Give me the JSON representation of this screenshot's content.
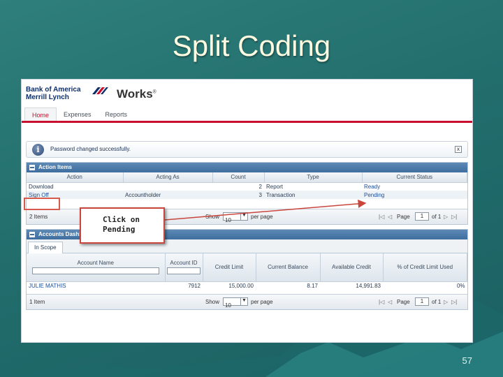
{
  "slide": {
    "title": "Split Coding",
    "page_number": "57"
  },
  "app": {
    "brand_line1": "Bank of America",
    "brand_line2": "Merrill Lynch",
    "product": "Works",
    "product_mark": "®",
    "nav": [
      {
        "label": "Home",
        "active": true
      },
      {
        "label": "Expenses",
        "active": false
      },
      {
        "label": "Reports",
        "active": false
      }
    ],
    "alert": {
      "icon": "info-icon",
      "message": "Password changed successfully.",
      "close": "x"
    }
  },
  "action_items": {
    "title": "Action Items",
    "columns": [
      "Action",
      "Acting As",
      "Count",
      "Type",
      "Current Status"
    ],
    "rows": [
      {
        "action": "Download",
        "acting_as": "",
        "count": "2",
        "type": "Report",
        "status": "Ready"
      },
      {
        "action": "Sign Off",
        "acting_as": "Accountholder",
        "count": "3",
        "type": "Transaction",
        "status": "Pending"
      }
    ],
    "pager": {
      "count_text": "2 Items",
      "show": "Show",
      "per_page_value": "10",
      "per_page": "per page",
      "page_label": "Page",
      "page_value": "1",
      "of_text": "of 1"
    }
  },
  "callout": {
    "line1": "Click on",
    "line2": "Pending"
  },
  "accounts_dashboard": {
    "title": "Accounts Dashboard",
    "tab": "In Scope",
    "columns": [
      "Account Name",
      "Account ID",
      "Credit Limit",
      "Current Balance",
      "Available Credit",
      "% of Credit Limit Used"
    ],
    "rows": [
      {
        "name": "JULIE MATHIS",
        "id": "7912",
        "credit_limit": "15,000.00",
        "current_balance": "8.17",
        "available_credit": "14,991.83",
        "pct_used": "0%"
      }
    ],
    "pager": {
      "count_text": "1 Item",
      "show": "Show",
      "per_page_value": "10",
      "per_page": "per page",
      "page_label": "Page",
      "page_value": "1",
      "of_text": "of 1"
    }
  },
  "colors": {
    "background": "#226e6d",
    "accent_red": "#c8102e",
    "panel_head": "#3f6e9f",
    "link": "#1c4d9c",
    "callout_border": "#c9463d"
  }
}
